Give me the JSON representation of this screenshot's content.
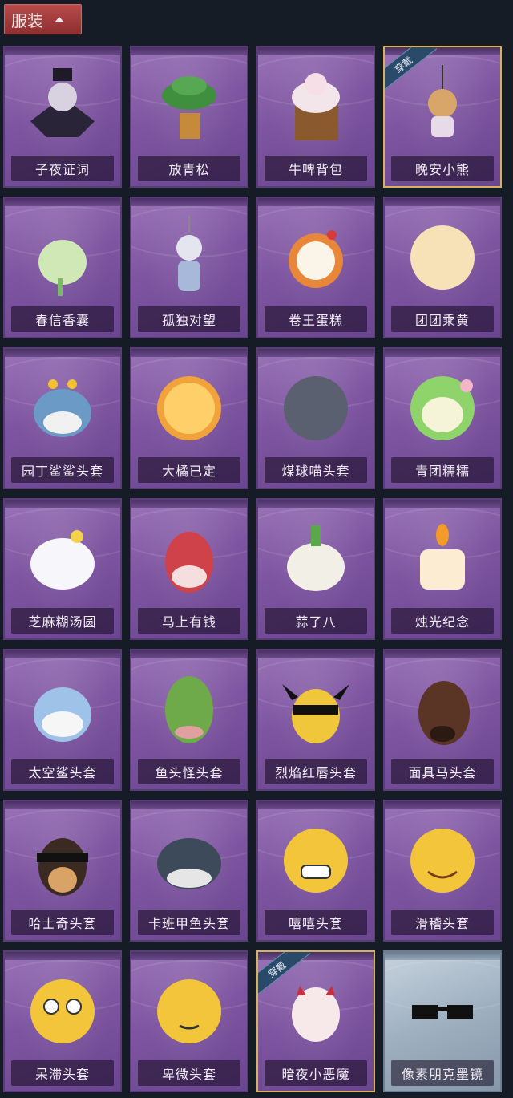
{
  "header": {
    "title": "服装"
  },
  "badge_text": "穿戴",
  "items": [
    {
      "name": "子夜证词",
      "equipped": false,
      "special": false,
      "icon": "dark-winged-bird-icon"
    },
    {
      "name": "放青松",
      "equipped": false,
      "special": false,
      "icon": "pine-tree-pot-icon"
    },
    {
      "name": "牛啤背包",
      "equipped": false,
      "special": false,
      "icon": "cow-beer-mug-icon"
    },
    {
      "name": "晚安小熊",
      "equipped": true,
      "special": false,
      "icon": "teddy-bear-charm-icon"
    },
    {
      "name": "春信香囊",
      "equipped": false,
      "special": false,
      "icon": "sachet-pouch-icon"
    },
    {
      "name": "孤独对望",
      "equipped": false,
      "special": false,
      "icon": "figure-charm-icon"
    },
    {
      "name": "卷王蛋糕",
      "equipped": false,
      "special": false,
      "icon": "roll-cake-icon"
    },
    {
      "name": "团团乘黄",
      "equipped": false,
      "special": false,
      "icon": "round-creature-icon"
    },
    {
      "name": "园丁鲨鲨头套",
      "equipped": false,
      "special": false,
      "icon": "shark-bee-head-icon"
    },
    {
      "name": "大橘已定",
      "equipped": false,
      "special": false,
      "icon": "orange-slice-icon"
    },
    {
      "name": "煤球喵头套",
      "equipped": false,
      "special": false,
      "icon": "black-cat-head-icon"
    },
    {
      "name": "青团糯糯",
      "equipped": false,
      "special": false,
      "icon": "green-dumpling-icon"
    },
    {
      "name": "芝麻糊汤圆",
      "equipped": false,
      "special": false,
      "icon": "rice-ball-icon"
    },
    {
      "name": "马上有钱",
      "equipped": false,
      "special": false,
      "icon": "red-horse-head-icon"
    },
    {
      "name": "蒜了八",
      "equipped": false,
      "special": false,
      "icon": "garlic-head-icon"
    },
    {
      "name": "烛光纪念",
      "equipped": false,
      "special": false,
      "icon": "candle-head-icon"
    },
    {
      "name": "太空鲨头套",
      "equipped": false,
      "special": false,
      "icon": "space-shark-head-icon"
    },
    {
      "name": "鱼头怪头套",
      "equipped": false,
      "special": false,
      "icon": "fish-mask-icon"
    },
    {
      "name": "烈焰红唇头套",
      "equipped": false,
      "special": false,
      "icon": "pikachu-sunglasses-icon"
    },
    {
      "name": "面具马头套",
      "equipped": false,
      "special": false,
      "icon": "horse-mask-icon"
    },
    {
      "name": "哈士奇头套",
      "equipped": false,
      "special": false,
      "icon": "husky-sunglasses-icon"
    },
    {
      "name": "卡班甲鱼头套",
      "equipped": false,
      "special": false,
      "icon": "fish-head-icon"
    },
    {
      "name": "嘻嘻头套",
      "equipped": false,
      "special": false,
      "icon": "grin-emoji-icon"
    },
    {
      "name": "滑稽头套",
      "equipped": false,
      "special": false,
      "icon": "smirk-emoji-icon"
    },
    {
      "name": "呆滞头套",
      "equipped": false,
      "special": false,
      "icon": "stare-emoji-icon"
    },
    {
      "name": "卑微头套",
      "equipped": false,
      "special": false,
      "icon": "pleading-emoji-icon"
    },
    {
      "name": "暗夜小恶魔",
      "equipped": true,
      "special": false,
      "icon": "little-devil-head-icon"
    },
    {
      "name": "像素朋克墨镜",
      "equipped": false,
      "special": true,
      "icon": "pixel-sunglasses-icon"
    }
  ],
  "colors": {
    "card_purple": "#7e55a0",
    "equipped_border": "#d8b25a",
    "header_red": "#a33c3d",
    "background": "#151c26"
  }
}
